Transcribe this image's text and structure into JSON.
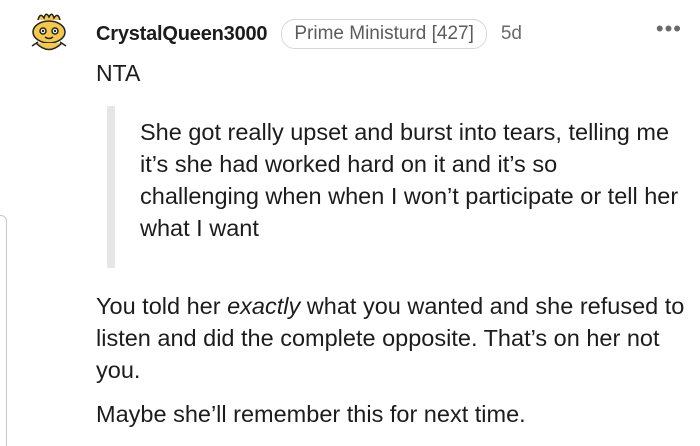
{
  "comment": {
    "author": "CrystalQueen3000",
    "flair": "Prime Ministurd [427]",
    "timestamp": "5d",
    "more_label": "•••",
    "avatar_icon": "snoo-avatar-icon",
    "verdict": "NTA",
    "quote": "She got really upset and burst into tears, telling me it’s she had worked hard on it and it’s so challenging when when I won’t participate or tell her what I want",
    "para1": {
      "before": "You told her ",
      "emphasis": "exactly",
      "after": " what you wanted and she refused to listen and did the complete opposite. That’s on her not you."
    },
    "para2": "Maybe she’ll remember this for next time."
  }
}
